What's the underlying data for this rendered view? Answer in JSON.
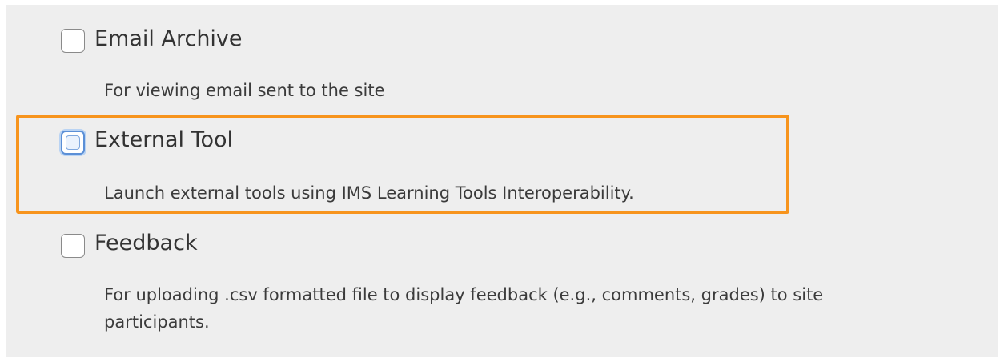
{
  "tools": [
    {
      "name": "Email Archive",
      "description": "For viewing email sent to the site",
      "checked": false
    },
    {
      "name": "External Tool",
      "description": "Launch external tools using IMS Learning Tools Interoperability.",
      "checked": false,
      "focused": true,
      "highlighted": true
    },
    {
      "name": "Feedback",
      "description": "For uploading .csv formatted file to display feedback (e.g., comments, grades) to site participants.",
      "checked": false
    }
  ],
  "colors": {
    "panel_background": "#eeeeee",
    "highlight_border": "#f7941d",
    "focus_ring": "#5b8fd6",
    "text": "#333333"
  }
}
